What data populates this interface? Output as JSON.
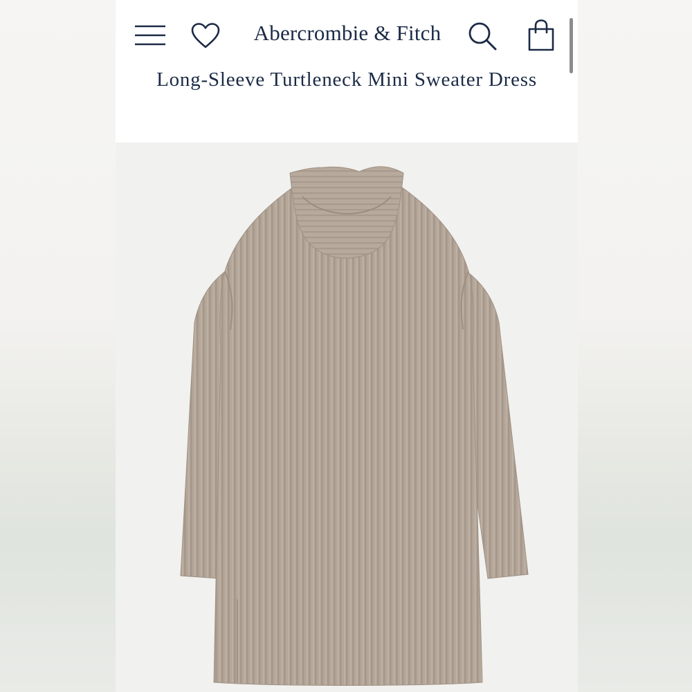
{
  "header": {
    "brand": "Abercrombie & Fitch",
    "product_title": "Long-Sleeve Turtleneck Mini Sweater Dress",
    "icons": {
      "menu": "hamburger-menu-icon",
      "wishlist": "heart-icon",
      "search": "search-icon",
      "bag": "shopping-bag-icon"
    }
  },
  "colors": {
    "brand_navy": "#1b2a45",
    "sweater": "#b3a698",
    "background": "#f1f1ef"
  }
}
